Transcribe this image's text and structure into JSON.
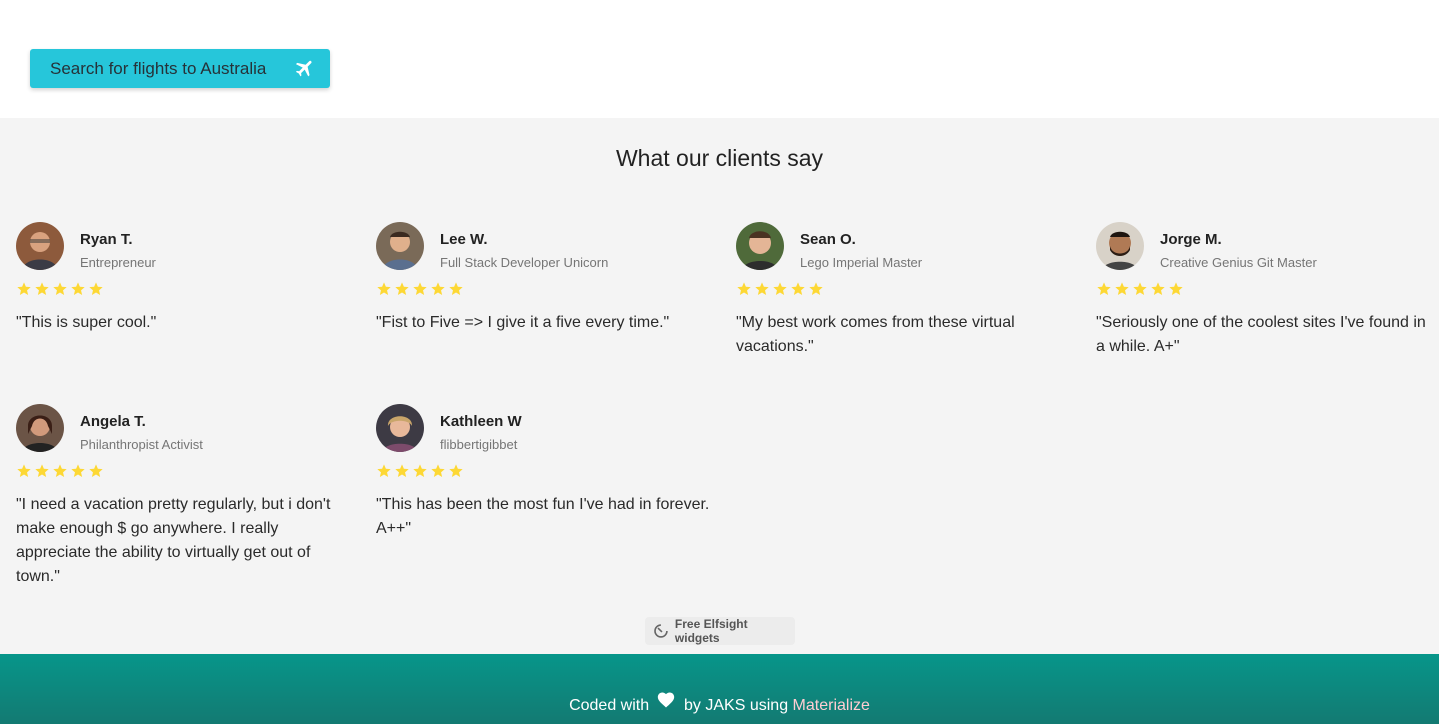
{
  "search_button": {
    "label": "Search for flights to Australia",
    "icon": "airplane-icon"
  },
  "reviews": {
    "heading": "What our clients say",
    "star_color": "#fdd835",
    "items": [
      {
        "name": "Ryan T.",
        "role": "Entrepreneur",
        "rating": 5,
        "quote": "\"This is super cool.\""
      },
      {
        "name": "Lee W.",
        "role": "Full Stack Developer Unicorn",
        "rating": 5,
        "quote": "\"Fist to Five => I give it a five every time.\""
      },
      {
        "name": "Sean O.",
        "role": "Lego Imperial Master",
        "rating": 5,
        "quote": "\"My best work comes from these virtual vacations.\""
      },
      {
        "name": "Jorge M.",
        "role": "Creative Genius Git Master",
        "rating": 5,
        "quote": "\"Seriously one of the coolest sites I've found in a while.  A+\""
      },
      {
        "name": "Angela T.",
        "role": "Philanthropist Activist",
        "rating": 5,
        "quote": "\"I need a vacation pretty regularly, but i don't make enough $ go anywhere.  I really appreciate the ability to virtually get out of town.\""
      },
      {
        "name": "Kathleen W",
        "role": "flibbertigibbet",
        "rating": 5,
        "quote": "\"This has been the most fun I've had in forever.  A++\""
      }
    ]
  },
  "elfsight_badge": {
    "label": "Free Elfsight widgets",
    "icon": "elfsight-logo-icon"
  },
  "footer": {
    "prefix": "Coded with",
    "icon": "heart-icon",
    "middle": "by JAKS using",
    "link": "Materialize",
    "link_color": "#ffcdd2",
    "bg_color": "#07968a"
  }
}
